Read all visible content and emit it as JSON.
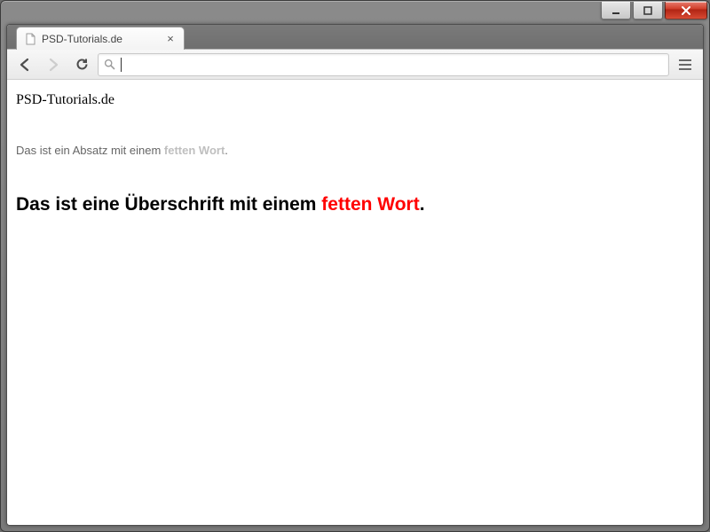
{
  "tab": {
    "title": "PSD-Tutorials.de"
  },
  "omnibox": {
    "value": ""
  },
  "content": {
    "site_title": "PSD-Tutorials.de",
    "para_before": "Das ist ein Absatz mit einem ",
    "para_bold": "fetten Wort",
    "para_after": ".",
    "head_before": "Das ist eine Überschrift mit einem ",
    "head_bold": "fetten Wort",
    "head_after": "."
  }
}
